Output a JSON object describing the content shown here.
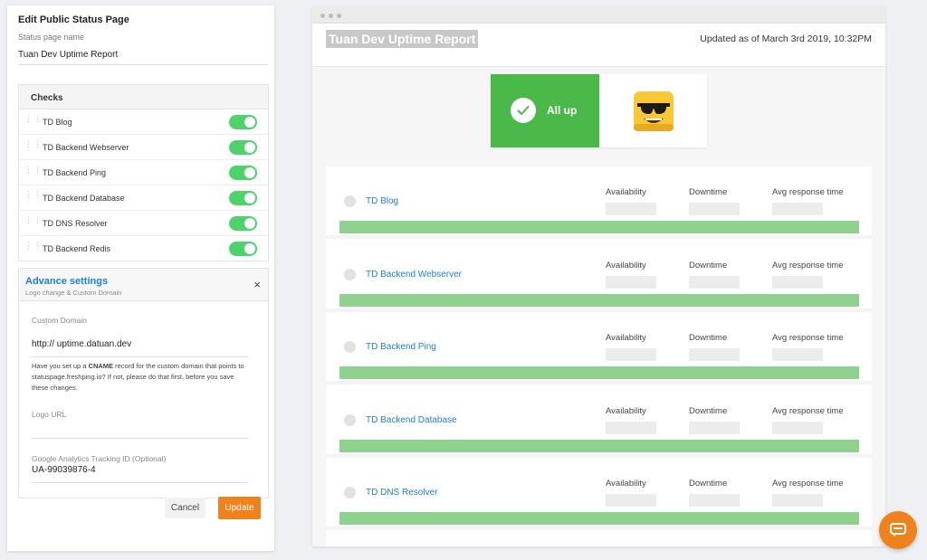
{
  "editor": {
    "title": "Edit Public Status Page",
    "name_label": "Status page name",
    "name_value": "Tuan Dev Uptime Report",
    "checks_header": "Checks",
    "checks": [
      {
        "name": "TD Blog",
        "enabled": true
      },
      {
        "name": "TD Backend Webserver",
        "enabled": true
      },
      {
        "name": "TD Backend Ping",
        "enabled": true
      },
      {
        "name": "TD Backend Database",
        "enabled": true
      },
      {
        "name": "TD DNS Resolver",
        "enabled": true
      },
      {
        "name": "TD Backend Redis",
        "enabled": true
      }
    ],
    "advanced": {
      "title": "Advance settings",
      "subtitle": "Logo change & Custom Domain",
      "close": "×",
      "custom_domain_label": "Custom Domain",
      "custom_domain_value": "http://  uptime.datuan.dev",
      "note_1": "Have you set up a ",
      "note_bold": "CNAME",
      "note_2": " record for the custom domain that points to statuspage.freshping.io? If not, please do that first, before you save these changes.",
      "logo_label": "Logo URL",
      "logo_value": "",
      "ga_label": "Google Analytics Tracking ID (Optional)",
      "ga_value": "UA-99039876-4"
    },
    "cancel_label": "Cancel",
    "update_label": "Update"
  },
  "preview": {
    "title": "Tuan Dev Uptime Report",
    "updated": "Updated as of March 3rd 2019, 10:32PM",
    "status_text": "All up",
    "columns": [
      "Availability",
      "Downtime",
      "Avg response time"
    ],
    "services": [
      {
        "name": "TD Blog"
      },
      {
        "name": "TD Backend Webserver"
      },
      {
        "name": "TD Backend Ping"
      },
      {
        "name": "TD Backend Database"
      },
      {
        "name": "TD DNS Resolver"
      }
    ]
  },
  "colors": {
    "accent": "#1d7fd6",
    "success": "#4bb94a",
    "uptime_bar": "#8fd18f",
    "action": "#f0821e",
    "toggle_on": "#4cd36a"
  }
}
